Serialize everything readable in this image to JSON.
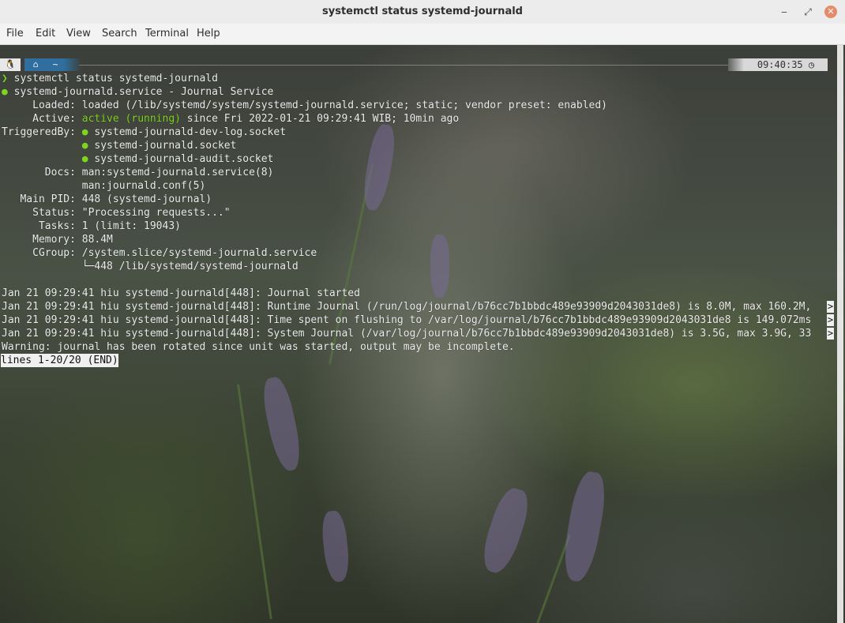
{
  "window": {
    "title": "systemctl status systemd-journald"
  },
  "controls": {
    "minimize": "‒",
    "maximize": "⤢",
    "close": "✕"
  },
  "menu": [
    "File",
    "Edit",
    "View",
    "Search",
    "Terminal",
    "Help"
  ],
  "prompt": {
    "os_icon": "linux-icon",
    "home_icon": "home-icon",
    "dir": "~",
    "time": "09:40:35",
    "clock_icon": "clock-icon",
    "prompt_char": "❯"
  },
  "command": "systemctl status systemd-journald",
  "status": {
    "service_line": "systemd-journald.service - Journal Service",
    "loaded": "     Loaded: loaded (/lib/systemd/system/systemd-journald.service; static; vendor preset: enabled)",
    "active_label": "     Active: ",
    "active_state": "active (running)",
    "active_rest": " since Fri 2022-01-21 09:29:41 WIB; 10min ago",
    "triggered_label": "TriggeredBy: ",
    "triggered": [
      "systemd-journald-dev-log.socket",
      "systemd-journald.socket",
      "systemd-journald-audit.socket"
    ],
    "docs1": "       Docs: man:systemd-journald.service(8)",
    "docs2": "             man:journald.conf(5)",
    "pid": "   Main PID: 448 (systemd-journal)",
    "stat": "     Status: \"Processing requests...\"",
    "tasks": "      Tasks: 1 (limit: 19043)",
    "memory": "     Memory: 88.4M",
    "cgroup": "     CGroup: /system.slice/systemd-journald.service",
    "cgroup_child": "             └─448 /lib/systemd/systemd-journald"
  },
  "log": [
    "Jan 21 09:29:41 hiu systemd-journald[448]: Journal started",
    "Jan 21 09:29:41 hiu systemd-journald[448]: Runtime Journal (/run/log/journal/b76cc7b1bbdc489e93909d2043031de8) is 8.0M, max 160.2M,",
    "Jan 21 09:29:41 hiu systemd-journald[448]: Time spent on flushing to /var/log/journal/b76cc7b1bbdc489e93909d2043031de8 is 149.072ms",
    "Jan 21 09:29:41 hiu systemd-journald[448]: System Journal (/var/log/journal/b76cc7b1bbdc489e93909d2043031de8) is 3.5G, max 3.9G, 33"
  ],
  "truncation_marker": ">",
  "warning": "Warning: journal has been rotated since unit was started, output may be incomplete.",
  "pager_status": "lines 1-20/20 (END)",
  "colors": {
    "accent_green": "#7fd321",
    "prompt_blue": "#2f6e9e",
    "close_button": "#e38b6a"
  }
}
